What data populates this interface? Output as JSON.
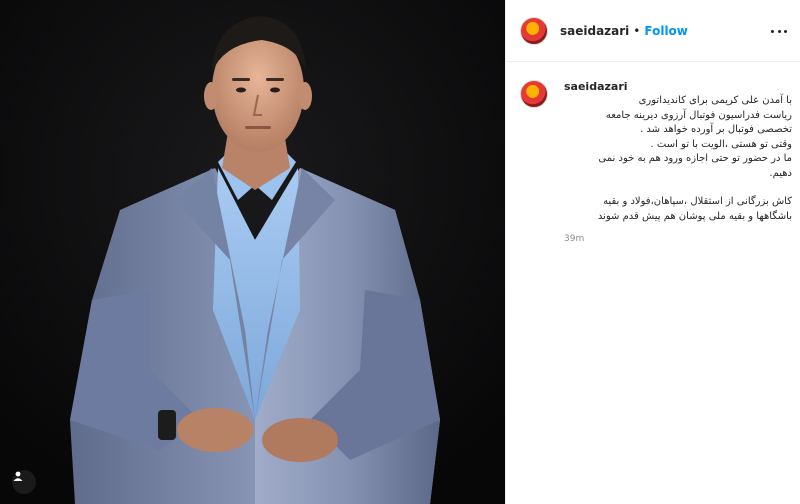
{
  "post": {
    "username": "saeidazari",
    "follow_label": "Follow",
    "separator": "•",
    "caption_lines": [
      "با آمدن علی کریمی برای کاندیداتوری",
      "ریاست فدراسیون فوتبال آرزوی دیرینه جامعه",
      "تخصصی فوتبال بر آورده خواهد شد .",
      "وقتی تو هستی ،الویت با تو است .",
      "ما در حضور تو حتی اجازه ورود هم به خود نمی",
      "دهیم.",
      "",
      "کاش بزرگانی از استقلال ،سپاهان،فولاد و بقیه",
      "باشگاهها و بقیه ملی پوشان هم پیش قدم شوند"
    ],
    "timestamp": "39m"
  },
  "icons": {
    "avatar": "profile-avatar-icon",
    "more": "more-options-icon",
    "tag": "user-tag-icon"
  },
  "colors": {
    "link_blue": "#0095f6",
    "photo_background": "#0b0b0c",
    "suit": "#8a98b8",
    "shirt": "#8fb7e8"
  }
}
